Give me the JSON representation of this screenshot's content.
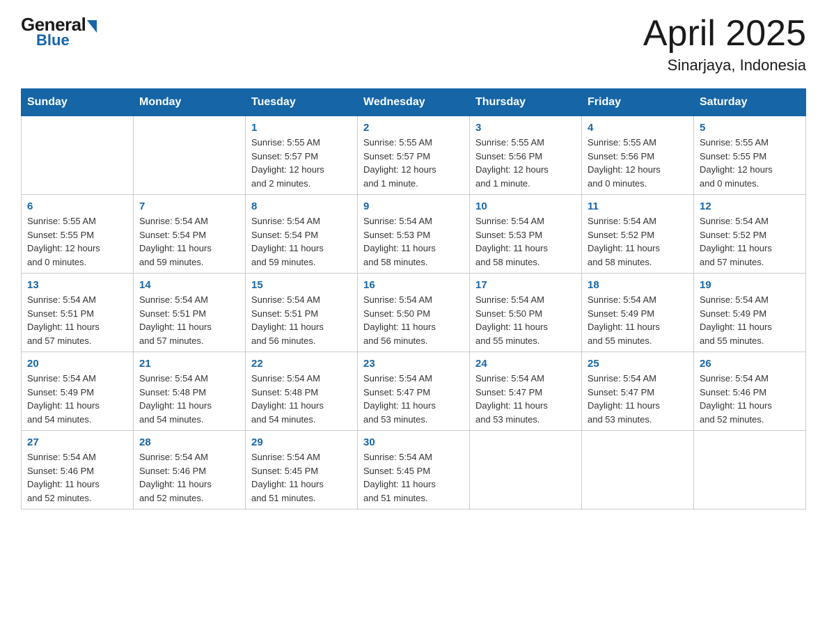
{
  "logo": {
    "general": "General",
    "blue": "Blue",
    "arrow": "▶"
  },
  "title": "April 2025",
  "location": "Sinarjaya, Indonesia",
  "days_header": [
    "Sunday",
    "Monday",
    "Tuesday",
    "Wednesday",
    "Thursday",
    "Friday",
    "Saturday"
  ],
  "weeks": [
    [
      {
        "day": "",
        "info": ""
      },
      {
        "day": "",
        "info": ""
      },
      {
        "day": "1",
        "info": "Sunrise: 5:55 AM\nSunset: 5:57 PM\nDaylight: 12 hours\nand 2 minutes."
      },
      {
        "day": "2",
        "info": "Sunrise: 5:55 AM\nSunset: 5:57 PM\nDaylight: 12 hours\nand 1 minute."
      },
      {
        "day": "3",
        "info": "Sunrise: 5:55 AM\nSunset: 5:56 PM\nDaylight: 12 hours\nand 1 minute."
      },
      {
        "day": "4",
        "info": "Sunrise: 5:55 AM\nSunset: 5:56 PM\nDaylight: 12 hours\nand 0 minutes."
      },
      {
        "day": "5",
        "info": "Sunrise: 5:55 AM\nSunset: 5:55 PM\nDaylight: 12 hours\nand 0 minutes."
      }
    ],
    [
      {
        "day": "6",
        "info": "Sunrise: 5:55 AM\nSunset: 5:55 PM\nDaylight: 12 hours\nand 0 minutes."
      },
      {
        "day": "7",
        "info": "Sunrise: 5:54 AM\nSunset: 5:54 PM\nDaylight: 11 hours\nand 59 minutes."
      },
      {
        "day": "8",
        "info": "Sunrise: 5:54 AM\nSunset: 5:54 PM\nDaylight: 11 hours\nand 59 minutes."
      },
      {
        "day": "9",
        "info": "Sunrise: 5:54 AM\nSunset: 5:53 PM\nDaylight: 11 hours\nand 58 minutes."
      },
      {
        "day": "10",
        "info": "Sunrise: 5:54 AM\nSunset: 5:53 PM\nDaylight: 11 hours\nand 58 minutes."
      },
      {
        "day": "11",
        "info": "Sunrise: 5:54 AM\nSunset: 5:52 PM\nDaylight: 11 hours\nand 58 minutes."
      },
      {
        "day": "12",
        "info": "Sunrise: 5:54 AM\nSunset: 5:52 PM\nDaylight: 11 hours\nand 57 minutes."
      }
    ],
    [
      {
        "day": "13",
        "info": "Sunrise: 5:54 AM\nSunset: 5:51 PM\nDaylight: 11 hours\nand 57 minutes."
      },
      {
        "day": "14",
        "info": "Sunrise: 5:54 AM\nSunset: 5:51 PM\nDaylight: 11 hours\nand 57 minutes."
      },
      {
        "day": "15",
        "info": "Sunrise: 5:54 AM\nSunset: 5:51 PM\nDaylight: 11 hours\nand 56 minutes."
      },
      {
        "day": "16",
        "info": "Sunrise: 5:54 AM\nSunset: 5:50 PM\nDaylight: 11 hours\nand 56 minutes."
      },
      {
        "day": "17",
        "info": "Sunrise: 5:54 AM\nSunset: 5:50 PM\nDaylight: 11 hours\nand 55 minutes."
      },
      {
        "day": "18",
        "info": "Sunrise: 5:54 AM\nSunset: 5:49 PM\nDaylight: 11 hours\nand 55 minutes."
      },
      {
        "day": "19",
        "info": "Sunrise: 5:54 AM\nSunset: 5:49 PM\nDaylight: 11 hours\nand 55 minutes."
      }
    ],
    [
      {
        "day": "20",
        "info": "Sunrise: 5:54 AM\nSunset: 5:49 PM\nDaylight: 11 hours\nand 54 minutes."
      },
      {
        "day": "21",
        "info": "Sunrise: 5:54 AM\nSunset: 5:48 PM\nDaylight: 11 hours\nand 54 minutes."
      },
      {
        "day": "22",
        "info": "Sunrise: 5:54 AM\nSunset: 5:48 PM\nDaylight: 11 hours\nand 54 minutes."
      },
      {
        "day": "23",
        "info": "Sunrise: 5:54 AM\nSunset: 5:47 PM\nDaylight: 11 hours\nand 53 minutes."
      },
      {
        "day": "24",
        "info": "Sunrise: 5:54 AM\nSunset: 5:47 PM\nDaylight: 11 hours\nand 53 minutes."
      },
      {
        "day": "25",
        "info": "Sunrise: 5:54 AM\nSunset: 5:47 PM\nDaylight: 11 hours\nand 53 minutes."
      },
      {
        "day": "26",
        "info": "Sunrise: 5:54 AM\nSunset: 5:46 PM\nDaylight: 11 hours\nand 52 minutes."
      }
    ],
    [
      {
        "day": "27",
        "info": "Sunrise: 5:54 AM\nSunset: 5:46 PM\nDaylight: 11 hours\nand 52 minutes."
      },
      {
        "day": "28",
        "info": "Sunrise: 5:54 AM\nSunset: 5:46 PM\nDaylight: 11 hours\nand 52 minutes."
      },
      {
        "day": "29",
        "info": "Sunrise: 5:54 AM\nSunset: 5:45 PM\nDaylight: 11 hours\nand 51 minutes."
      },
      {
        "day": "30",
        "info": "Sunrise: 5:54 AM\nSunset: 5:45 PM\nDaylight: 11 hours\nand 51 minutes."
      },
      {
        "day": "",
        "info": ""
      },
      {
        "day": "",
        "info": ""
      },
      {
        "day": "",
        "info": ""
      }
    ]
  ]
}
